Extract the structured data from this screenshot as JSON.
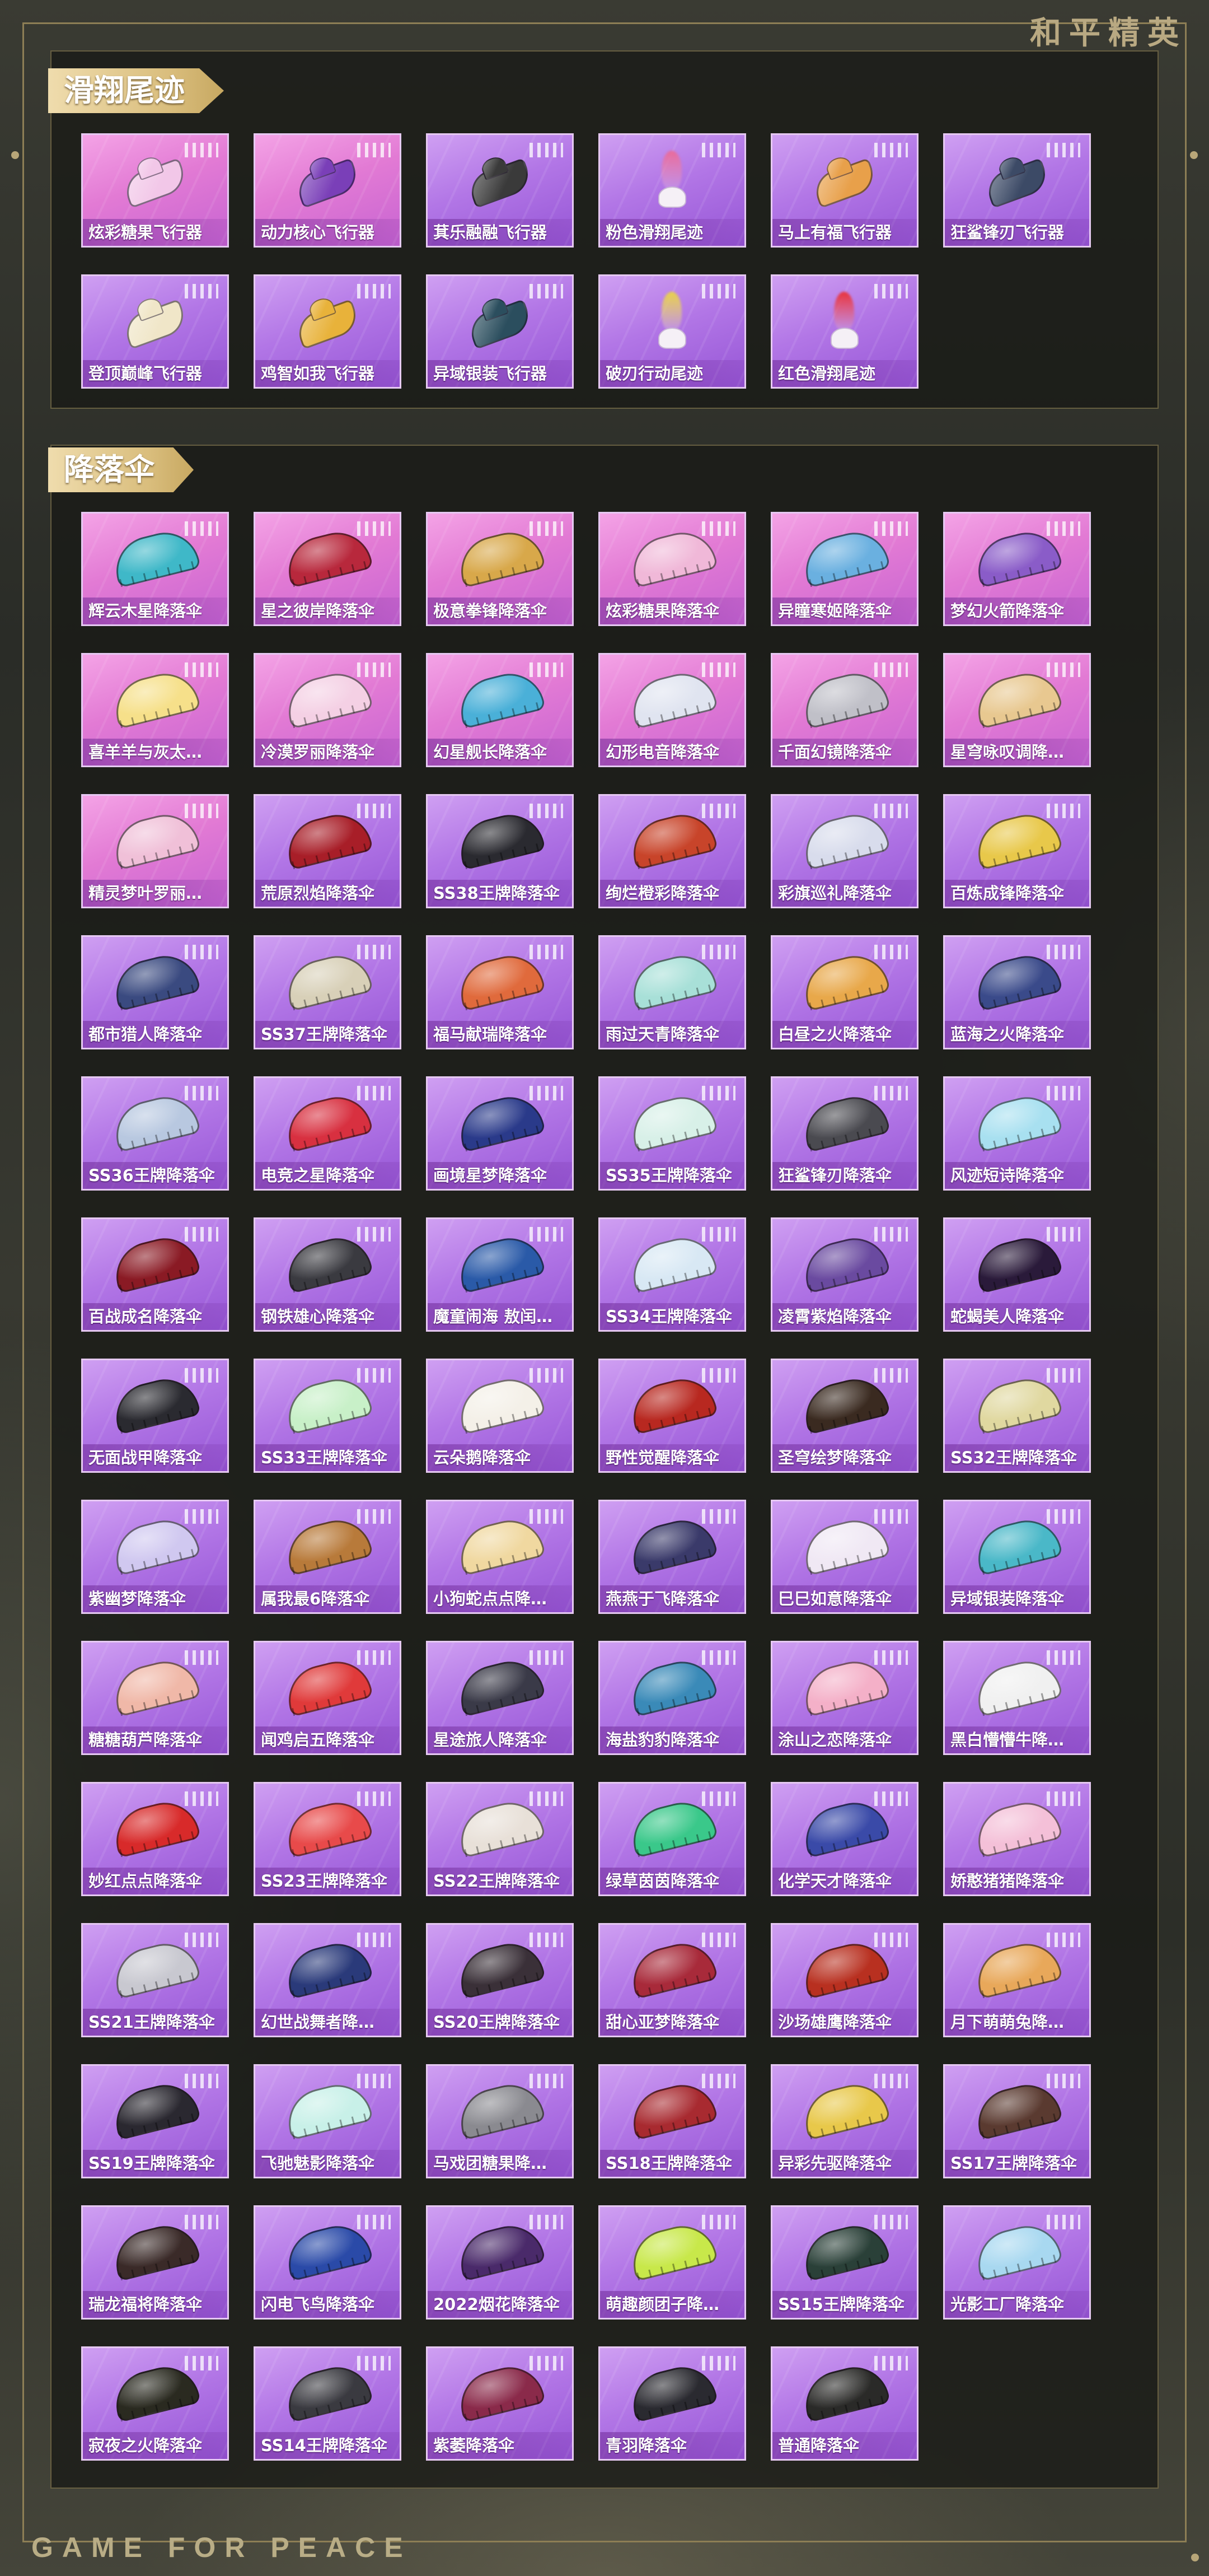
{
  "brand_text": "和平精英",
  "footer_text": "GAME FOR PEACE",
  "sections": {
    "trails": {
      "title": "滑翔尾迹",
      "items": [
        {
          "label": "炫彩糖果飞行器",
          "kind": "glider",
          "bg": "pink",
          "color": "#f2c7e8"
        },
        {
          "label": "动力核心飞行器",
          "kind": "glider",
          "bg": "pink",
          "color": "#7a3fb8"
        },
        {
          "label": "萁乐融融飞行器",
          "kind": "glider",
          "bg": "purple",
          "color": "#3a3a3a"
        },
        {
          "label": "粉色滑翔尾迹",
          "kind": "trail",
          "bg": "purple",
          "color": "#e86a9a"
        },
        {
          "label": "马上有福飞行器",
          "kind": "glider",
          "bg": "purple",
          "color": "#e8a04a"
        },
        {
          "label": "狂鲨锋刃飞行器",
          "kind": "glider",
          "bg": "purple",
          "color": "#3c4a66"
        },
        {
          "label": "登顶巅峰飞行器",
          "kind": "glider",
          "bg": "purple",
          "color": "#f0e6c8"
        },
        {
          "label": "鸡智如我飞行器",
          "kind": "glider",
          "bg": "purple",
          "color": "#e8b23a"
        },
        {
          "label": "异域银装飞行器",
          "kind": "glider",
          "bg": "purple",
          "color": "#2b4e5e"
        },
        {
          "label": "破刃行动尾迹",
          "kind": "trail",
          "bg": "purple",
          "color": "#e8d04a"
        },
        {
          "label": "红色滑翔尾迹",
          "kind": "trail",
          "bg": "purple",
          "color": "#e8323c"
        }
      ]
    },
    "parachutes": {
      "title": "降落伞",
      "items": [
        {
          "label": "辉云木星降落伞",
          "kind": "canopy",
          "bg": "pink",
          "color": "#3fb8c8"
        },
        {
          "label": "星之彼岸降落伞",
          "kind": "canopy",
          "bg": "pink",
          "color": "#b8283c"
        },
        {
          "label": "极意拳锋降落伞",
          "kind": "canopy",
          "bg": "pink",
          "color": "#d8a84a"
        },
        {
          "label": "炫彩糖果降落伞",
          "kind": "canopy",
          "bg": "pink",
          "color": "#f0b8d8"
        },
        {
          "label": "异瞳寒姬降落伞",
          "kind": "canopy",
          "bg": "pink",
          "color": "#6ab0e0"
        },
        {
          "label": "梦幻火箭降落伞",
          "kind": "canopy",
          "bg": "pink",
          "color": "#8a5cc8"
        },
        {
          "label": "喜羊羊与灰太…",
          "kind": "canopy",
          "bg": "pink",
          "color": "#f6e08a"
        },
        {
          "label": "冷漠罗丽降落伞",
          "kind": "canopy",
          "bg": "pink",
          "color": "#f4d0e4"
        },
        {
          "label": "幻星舰长降落伞",
          "kind": "canopy",
          "bg": "pink",
          "color": "#4ab0d8"
        },
        {
          "label": "幻形电音降落伞",
          "kind": "canopy",
          "bg": "pink",
          "color": "#e0e4f0"
        },
        {
          "label": "千面幻镜降落伞",
          "kind": "canopy",
          "bg": "pink",
          "color": "#c0c0c8"
        },
        {
          "label": "星穹咏叹调降…",
          "kind": "canopy",
          "bg": "pink",
          "color": "#e8c890"
        },
        {
          "label": "精灵梦叶罗丽…",
          "kind": "canopy",
          "bg": "pink",
          "color": "#f0c0d8"
        },
        {
          "label": "荒原烈焰降落伞",
          "kind": "canopy",
          "bg": "purple",
          "color": "#a81e28"
        },
        {
          "label": "SS38王牌降落伞",
          "kind": "canopy",
          "bg": "purple",
          "color": "#2a2a30"
        },
        {
          "label": "绚烂橙彩降落伞",
          "kind": "canopy",
          "bg": "purple",
          "color": "#c8442a"
        },
        {
          "label": "彩旗巡礼降落伞",
          "kind": "canopy",
          "bg": "purple",
          "color": "#d8dcec"
        },
        {
          "label": "百炼成锋降落伞",
          "kind": "canopy",
          "bg": "purple",
          "color": "#e8c84a"
        },
        {
          "label": "都市猎人降落伞",
          "kind": "canopy",
          "bg": "purple",
          "color": "#3a4a80"
        },
        {
          "label": "SS37王牌降落伞",
          "kind": "canopy",
          "bg": "purple",
          "color": "#d8d0b8"
        },
        {
          "label": "福马献瑞降落伞",
          "kind": "canopy",
          "bg": "purple",
          "color": "#e06a3c"
        },
        {
          "label": "雨过天青降落伞",
          "kind": "canopy",
          "bg": "purple",
          "color": "#a8e0d8"
        },
        {
          "label": "白昼之火降落伞",
          "kind": "canopy",
          "bg": "purple",
          "color": "#e8a84a"
        },
        {
          "label": "蓝海之火降落伞",
          "kind": "canopy",
          "bg": "purple",
          "color": "#3a4a8a"
        },
        {
          "label": "SS36王牌降落伞",
          "kind": "canopy",
          "bg": "purple",
          "color": "#b8c8e0"
        },
        {
          "label": "电竞之星降落伞",
          "kind": "canopy",
          "bg": "purple",
          "color": "#d83040"
        },
        {
          "label": "画境星梦降落伞",
          "kind": "canopy",
          "bg": "purple",
          "color": "#2a3a8a"
        },
        {
          "label": "SS35王牌降落伞",
          "kind": "canopy",
          "bg": "purple",
          "color": "#d8f0e8"
        },
        {
          "label": "狂鲨锋刃降落伞",
          "kind": "canopy",
          "bg": "purple",
          "color": "#4a4a50"
        },
        {
          "label": "风迹短诗降落伞",
          "kind": "canopy",
          "bg": "purple",
          "color": "#a8e0f0"
        },
        {
          "label": "百战成名降落伞",
          "kind": "canopy",
          "bg": "purple",
          "color": "#8a1a24"
        },
        {
          "label": "钢铁雄心降落伞",
          "kind": "canopy",
          "bg": "purple",
          "color": "#3a3a40"
        },
        {
          "label": "魔童闹海 敖闰…",
          "kind": "canopy",
          "bg": "purple",
          "color": "#2a5aa8"
        },
        {
          "label": "SS34王牌降落伞",
          "kind": "canopy",
          "bg": "purple",
          "color": "#d8e8f4"
        },
        {
          "label": "凌霄紫焰降落伞",
          "kind": "canopy",
          "bg": "purple",
          "color": "#6a4aa0"
        },
        {
          "label": "蛇蝎美人降落伞",
          "kind": "canopy",
          "bg": "purple",
          "color": "#2a1a3a"
        },
        {
          "label": "无面战甲降落伞",
          "kind": "canopy",
          "bg": "purple",
          "color": "#2a2a30"
        },
        {
          "label": "SS33王牌降落伞",
          "kind": "canopy",
          "bg": "purple",
          "color": "#c8f0c8"
        },
        {
          "label": "云朵鹅降落伞",
          "kind": "canopy",
          "bg": "purple",
          "color": "#f4f0e8"
        },
        {
          "label": "野性觉醒降落伞",
          "kind": "canopy",
          "bg": "purple",
          "color": "#b82820"
        },
        {
          "label": "圣穹绘梦降落伞",
          "kind": "canopy",
          "bg": "purple",
          "color": "#3a2a20"
        },
        {
          "label": "SS32王牌降落伞",
          "kind": "canopy",
          "bg": "purple",
          "color": "#e0d8a0"
        },
        {
          "label": "紫幽梦降落伞",
          "kind": "canopy",
          "bg": "purple",
          "color": "#d0c8f0"
        },
        {
          "label": "属我最6降落伞",
          "kind": "canopy",
          "bg": "purple",
          "color": "#b87a3a"
        },
        {
          "label": "小狗蛇点点降…",
          "kind": "canopy",
          "bg": "purple",
          "color": "#f0d8a0"
        },
        {
          "label": "燕燕于飞降落伞",
          "kind": "canopy",
          "bg": "purple",
          "color": "#3a3a6a"
        },
        {
          "label": "巳巳如意降落伞",
          "kind": "canopy",
          "bg": "purple",
          "color": "#f0e8f4"
        },
        {
          "label": "异域银装降落伞",
          "kind": "canopy",
          "bg": "purple",
          "color": "#4ab8c8"
        },
        {
          "label": "糖糖葫芦降落伞",
          "kind": "canopy",
          "bg": "purple",
          "color": "#f0b8a8"
        },
        {
          "label": "闻鸡启五降落伞",
          "kind": "canopy",
          "bg": "purple",
          "color": "#e03a3a"
        },
        {
          "label": "星途旅人降落伞",
          "kind": "canopy",
          "bg": "purple",
          "color": "#3a3a48"
        },
        {
          "label": "海盐豹豹降落伞",
          "kind": "canopy",
          "bg": "purple",
          "color": "#3a8ab8"
        },
        {
          "label": "涂山之恋降落伞",
          "kind": "canopy",
          "bg": "purple",
          "color": "#f4b0c8"
        },
        {
          "label": "黑白懵懵牛降…",
          "kind": "canopy",
          "bg": "purple",
          "color": "#f0f0f0"
        },
        {
          "label": "妙红点点降落伞",
          "kind": "canopy",
          "bg": "purple",
          "color": "#d82a2a"
        },
        {
          "label": "SS23王牌降落伞",
          "kind": "canopy",
          "bg": "purple",
          "color": "#e84a4a"
        },
        {
          "label": "SS22王牌降落伞",
          "kind": "canopy",
          "bg": "purple",
          "color": "#e8e0d8"
        },
        {
          "label": "绿草茵茵降落伞",
          "kind": "canopy",
          "bg": "purple",
          "color": "#3ac88a"
        },
        {
          "label": "化学天才降落伞",
          "kind": "canopy",
          "bg": "purple",
          "color": "#3a4aa8"
        },
        {
          "label": "娇憨猪猪降落伞",
          "kind": "canopy",
          "bg": "purple",
          "color": "#f4c0d8"
        },
        {
          "label": "SS21王牌降落伞",
          "kind": "canopy",
          "bg": "purple",
          "color": "#c8c8d0"
        },
        {
          "label": "幻世战舞者降…",
          "kind": "canopy",
          "bg": "purple",
          "color": "#2a3a7a"
        },
        {
          "label": "SS20王牌降落伞",
          "kind": "canopy",
          "bg": "purple",
          "color": "#3a3038"
        },
        {
          "label": "甜心亚梦降落伞",
          "kind": "canopy",
          "bg": "purple",
          "color": "#a82a3a"
        },
        {
          "label": "沙场雄鹰降落伞",
          "kind": "canopy",
          "bg": "purple",
          "color": "#b83020"
        },
        {
          "label": "月下萌萌兔降…",
          "kind": "canopy",
          "bg": "purple",
          "color": "#e8a85a"
        },
        {
          "label": "SS19王牌降落伞",
          "kind": "canopy",
          "bg": "purple",
          "color": "#2a2830"
        },
        {
          "label": "飞驰魅影降落伞",
          "kind": "canopy",
          "bg": "purple",
          "color": "#c8f0e8"
        },
        {
          "label": "马戏团糖果降…",
          "kind": "canopy",
          "bg": "purple",
          "color": "#8a8a90"
        },
        {
          "label": "SS18王牌降落伞",
          "kind": "canopy",
          "bg": "purple",
          "color": "#a82a30"
        },
        {
          "label": "异彩先驱降落伞",
          "kind": "canopy",
          "bg": "purple",
          "color": "#e8c84a"
        },
        {
          "label": "SS17王牌降落伞",
          "kind": "canopy",
          "bg": "purple",
          "color": "#5a3a30"
        },
        {
          "label": "瑞龙福将降落伞",
          "kind": "canopy",
          "bg": "purple",
          "color": "#3a2a28"
        },
        {
          "label": "闪电飞鸟降落伞",
          "kind": "canopy",
          "bg": "purple",
          "color": "#2a4aa8"
        },
        {
          "label": "2022烟花降落伞",
          "kind": "canopy",
          "bg": "purple",
          "color": "#4a2a6a"
        },
        {
          "label": "萌趣颜团子降…",
          "kind": "canopy",
          "bg": "purple",
          "color": "#c8e84a"
        },
        {
          "label": "SS15王牌降落伞",
          "kind": "canopy",
          "bg": "purple",
          "color": "#2a4038"
        },
        {
          "label": "光影工厂降落伞",
          "kind": "canopy",
          "bg": "purple",
          "color": "#a8d8f0"
        },
        {
          "label": "寂夜之火降落伞",
          "kind": "canopy",
          "bg": "purple",
          "color": "#2a2a20"
        },
        {
          "label": "SS14王牌降落伞",
          "kind": "canopy",
          "bg": "purple",
          "color": "#3a3a40"
        },
        {
          "label": "紫萎降落伞",
          "kind": "canopy",
          "bg": "purple",
          "color": "#8a2a4a"
        },
        {
          "label": "青羽降落伞",
          "kind": "canopy",
          "bg": "purple",
          "color": "#2a2a30"
        },
        {
          "label": "普通降落伞",
          "kind": "canopy",
          "bg": "purple",
          "color": "#2a2a28"
        }
      ]
    }
  }
}
